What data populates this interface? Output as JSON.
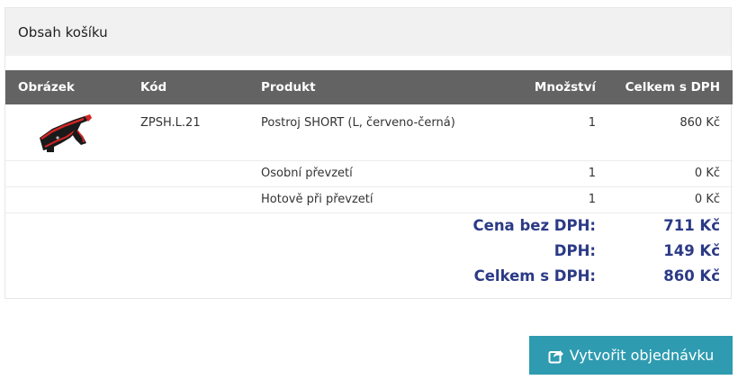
{
  "cart": {
    "title": "Obsah košíku",
    "columns": {
      "image": "Obrázek",
      "code": "Kód",
      "product": "Produkt",
      "qty": "Množství",
      "total": "Celkem s DPH"
    },
    "items": [
      {
        "image": "harness-image",
        "code": "ZPSH.L.21",
        "product": "Postroj SHORT (L, červeno-černá)",
        "qty": "1",
        "total": "860 Kč"
      }
    ],
    "extras": [
      {
        "label": "Osobní převzetí",
        "qty": "1",
        "total": "0 Kč"
      },
      {
        "label": "Hotově při převzetí",
        "qty": "1",
        "total": "0 Kč"
      }
    ],
    "summary": [
      {
        "label": "Cena bez DPH:",
        "value": "711 Kč"
      },
      {
        "label": "DPH:",
        "value": "149 Kč"
      },
      {
        "label": "Celkem s DPH:",
        "value": "860 Kč"
      }
    ]
  },
  "actions": {
    "create_order_label": "Vytvořit objednávku",
    "create_order_icon": "share-icon"
  },
  "colors": {
    "header_bg": "#636363",
    "summary_text": "#2b3a86",
    "button_bg": "#2e9bb0"
  }
}
